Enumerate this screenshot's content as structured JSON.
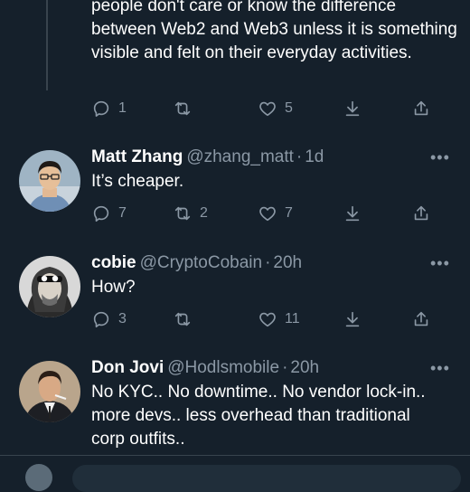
{
  "thread": {
    "continued_text": "people don't care or know the difference between Web2 and Web3 unless it is something visible and felt on their everyday activities.",
    "reply_count": "1",
    "like_count": "5"
  },
  "tweets": [
    {
      "name": "Matt Zhang",
      "handle": "@zhang_matt",
      "sep": "·",
      "time": "1d",
      "text": "It’s cheaper.",
      "reply_count": "7",
      "retweet_count": "2",
      "like_count": "7"
    },
    {
      "name": "cobie",
      "handle": "@CryptoCobain",
      "sep": "·",
      "time": "20h",
      "text": "How?",
      "reply_count": "3",
      "retweet_count": "",
      "like_count": "11"
    },
    {
      "name": "Don Jovi",
      "handle": "@Hodlsmobile",
      "sep": "·",
      "time": "20h",
      "text": "No KYC..  No downtime..  No vendor lock-in..  more devs..  less overhead than traditional corp outfits.."
    }
  ],
  "more_glyph": "•••",
  "icons": [
    "reply-icon",
    "retweet-icon",
    "like-icon",
    "bookmark-icon",
    "share-icon",
    "more-icon"
  ]
}
